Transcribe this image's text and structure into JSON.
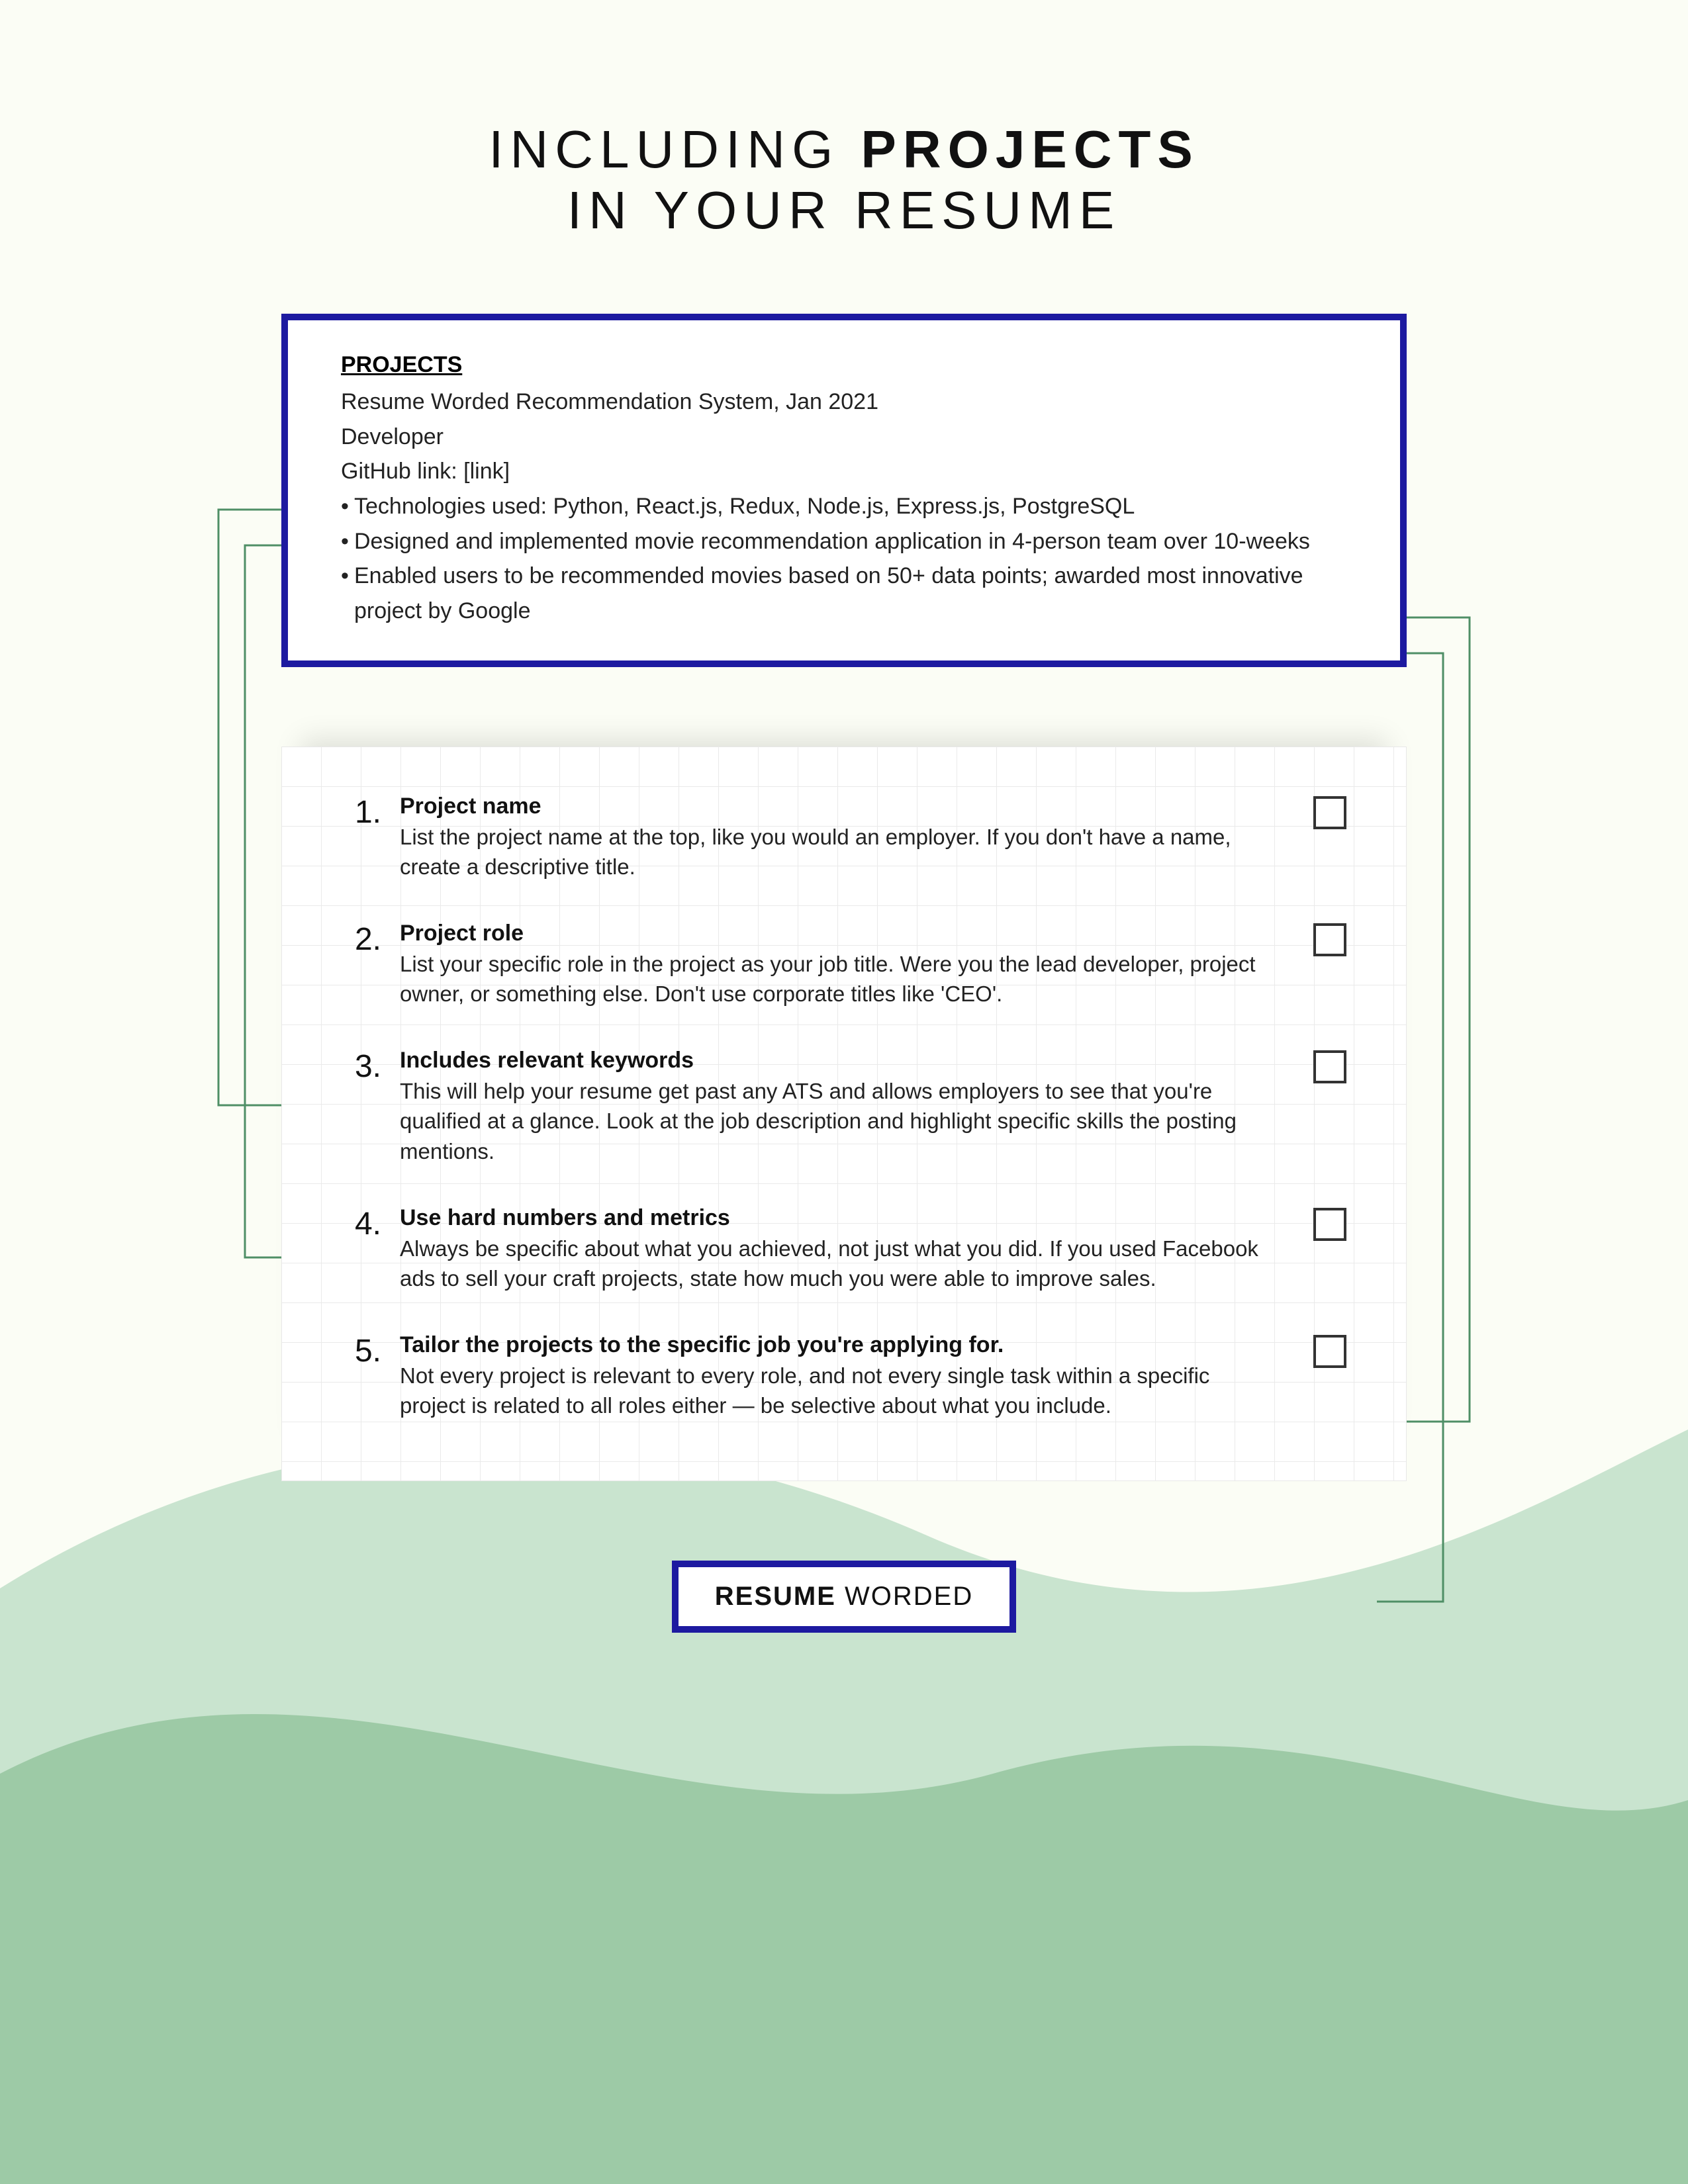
{
  "title": {
    "pre": "INCLUDING ",
    "bold": "PROJECTS",
    "line2": "IN YOUR RESUME"
  },
  "example": {
    "heading": "PROJECTS",
    "line1": "Resume Worded Recommendation System, Jan 2021",
    "line2": "Developer",
    "line3": "GitHub link: [link]",
    "bullet1": "Technologies used: Python, React.js, Redux, Node.js, Express.js, PostgreSQL",
    "bullet2": "Designed and implemented movie recommendation application in 4-person team over 10-weeks",
    "bullet3": "Enabled users to be recommended movies based on 50+ data points; awarded most innovative project by Google"
  },
  "checklist": [
    {
      "num": "1.",
      "title": "Project name",
      "desc": "List the project name at the top, like you would an employer. If you don't have a name, create a descriptive title."
    },
    {
      "num": "2.",
      "title": "Project role",
      "desc": "List your specific role in the project as your job title. Were you the lead developer, project owner, or something else. Don't use corporate titles like 'CEO'."
    },
    {
      "num": "3.",
      "title": "Includes relevant keywords",
      "desc": "This will help your resume get past any ATS and allows employers to see that you're qualified at a glance. Look at the job description and highlight specific skills the posting mentions."
    },
    {
      "num": "4.",
      "title": "Use hard numbers and metrics",
      "desc": "Always be specific about what you achieved, not just what you did. If you used Facebook ads to sell your craft projects, state how much you were able to improve sales."
    },
    {
      "num": "5.",
      "title": "Tailor the projects to the specific job you're applying for.",
      "desc": "Not every project is relevant to every role, and not every single task within a specific project is related to all roles either — be selective about what you include."
    }
  ],
  "footer": {
    "bold": "RESUME",
    "light": " WORDED"
  },
  "colors": {
    "accent": "#1d1aa0",
    "connector": "#4f8f66",
    "wave_light": "#c9e4cf",
    "wave_dark": "#9dcaa6"
  }
}
